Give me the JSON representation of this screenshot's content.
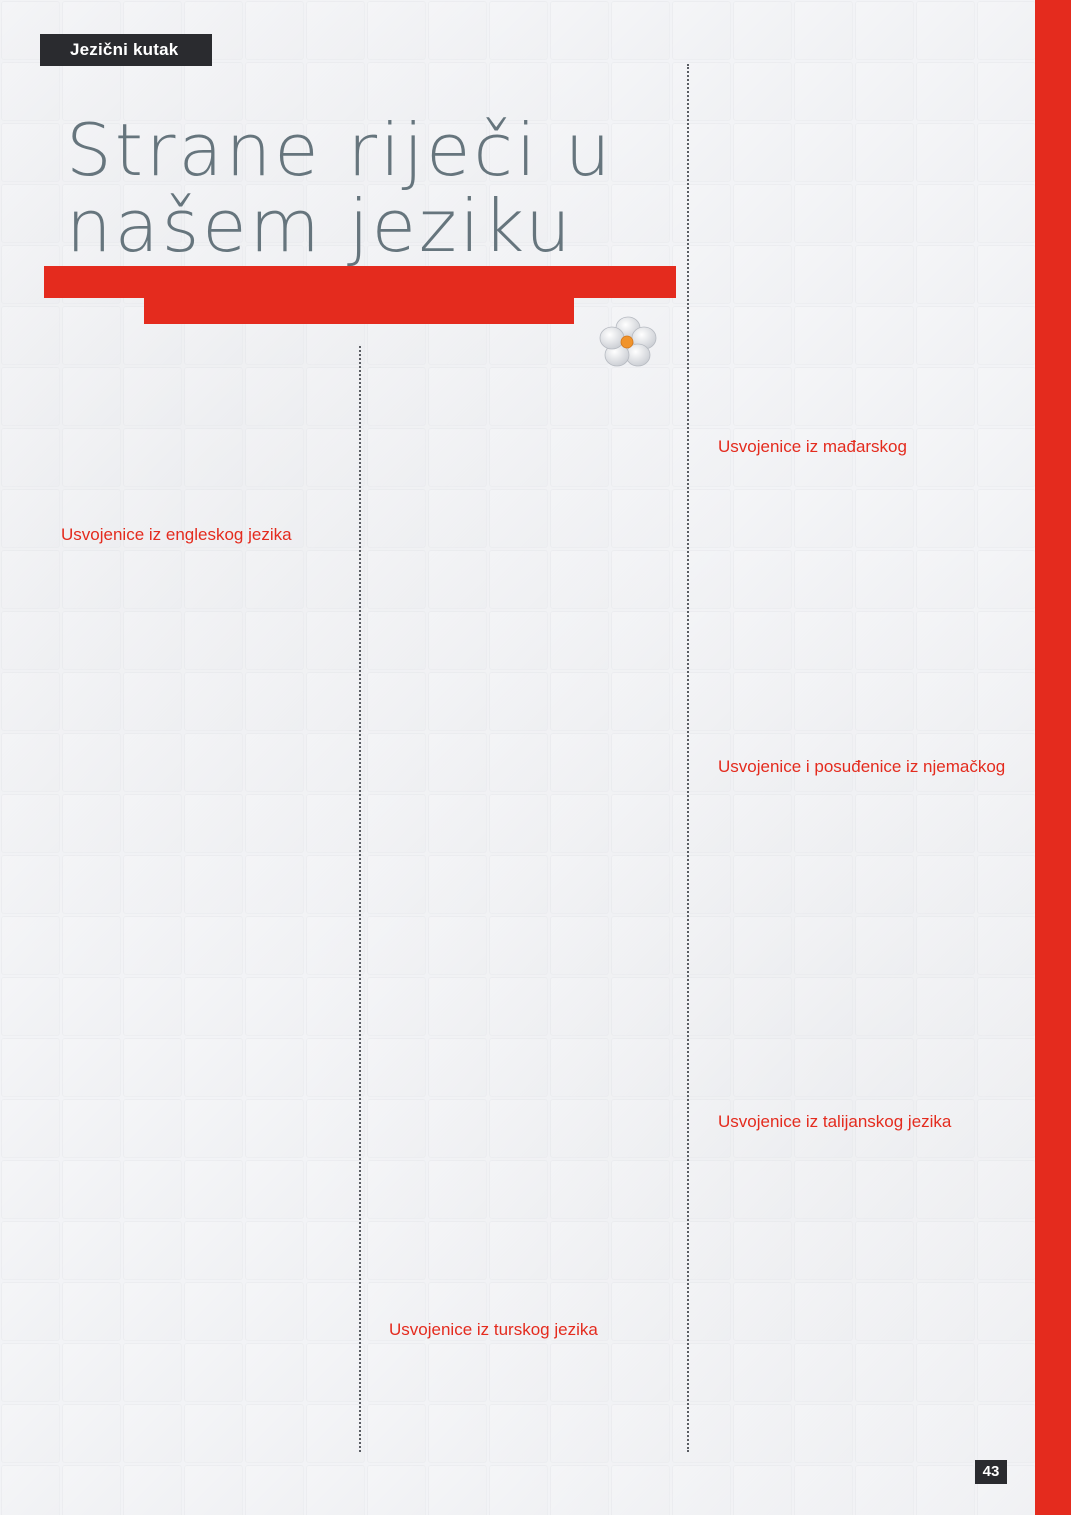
{
  "section_tag": "Jezični kutak",
  "title": {
    "line1": "Strane riječi u",
    "line2": "našem jeziku"
  },
  "headings": {
    "english": "Usvojenice iz engleskog jezika",
    "hungarian": "Usvojenice iz mađarskog",
    "german": "Usvojenice i posuđenice iz njemačkog",
    "italian": "Usvojenice iz talijanskog jezika",
    "turkish": "Usvojenice iz turskog jezika"
  },
  "page_number": "43",
  "colors": {
    "accent_red": "#e42b1e",
    "title_gray": "#66757d",
    "tag_dark": "#2a2b2f"
  }
}
